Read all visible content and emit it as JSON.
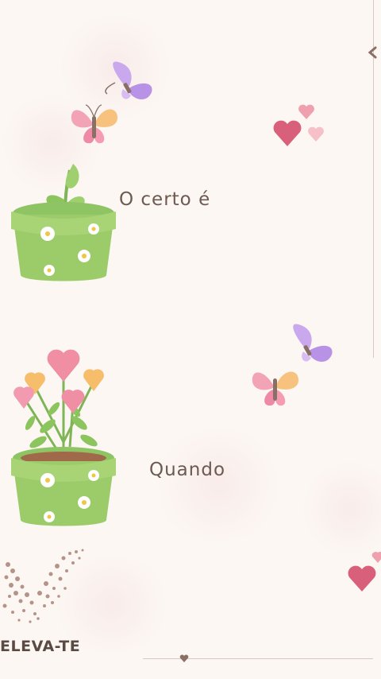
{
  "captions": {
    "first": "O certo é",
    "second": "Quando"
  },
  "logo": {
    "text": "ELEVA-TE"
  },
  "colors": {
    "background": "#fcf7f3",
    "pot": "#9ccb6a",
    "text": "#6c5a52",
    "heart": "#d9607a"
  }
}
